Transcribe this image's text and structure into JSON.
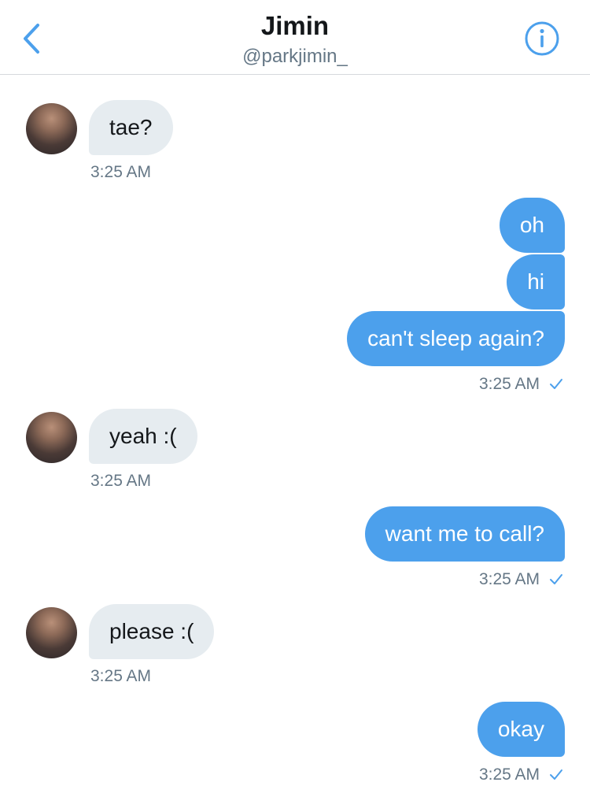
{
  "header": {
    "name": "Jimin",
    "handle": "@parkjimin_",
    "back_icon": "chevron-left-icon",
    "info_icon": "info-icon",
    "accent_color": "#4ca0ec"
  },
  "messages": [
    {
      "direction": "in",
      "text": "tae?",
      "time": "3:25 AM"
    },
    {
      "direction": "out",
      "text": "oh"
    },
    {
      "direction": "out",
      "text": "hi"
    },
    {
      "direction": "out",
      "text": "can't sleep again?",
      "time": "3:25 AM",
      "status": "sent-check"
    },
    {
      "direction": "in",
      "text": "yeah :(",
      "time": "3:25 AM"
    },
    {
      "direction": "out",
      "text": "want me to call?",
      "time": "3:25 AM",
      "status": "sent-check"
    },
    {
      "direction": "in",
      "text": "please :(",
      "time": "3:25 AM"
    },
    {
      "direction": "out",
      "text": "okay",
      "time": "3:25 AM",
      "status": "sent-check"
    }
  ],
  "colors": {
    "incoming_bubble": "#e6ecf0",
    "outgoing_bubble": "#4ca0ec",
    "timestamp": "#657786"
  }
}
